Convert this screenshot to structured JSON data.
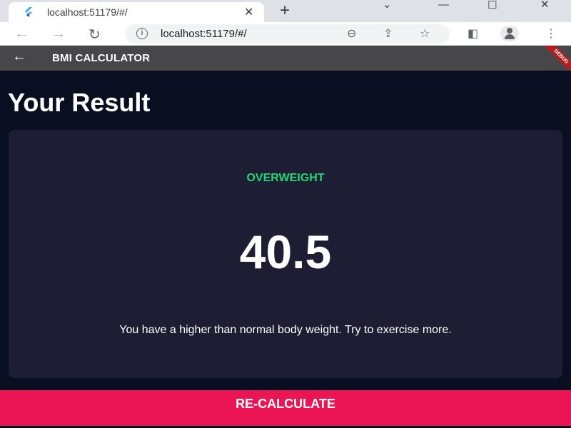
{
  "browser": {
    "tab_title": "localhost:51179/#/",
    "url": "localhost:51179/#/",
    "favicon": "flutter-icon"
  },
  "app": {
    "title": "BMI CALCULATOR",
    "debug_label": "DEBUG"
  },
  "result": {
    "heading": "Your Result",
    "status": "OVERWEIGHT",
    "bmi": "40.5",
    "advice": "You have a higher than normal body weight. Try to exercise more.",
    "button_label": "RE-CALCULATE"
  },
  "colors": {
    "background": "#0a0e21",
    "card": "#1d1e33",
    "status": "#24d876",
    "button": "#eb1555",
    "appbar": "#47474a"
  }
}
